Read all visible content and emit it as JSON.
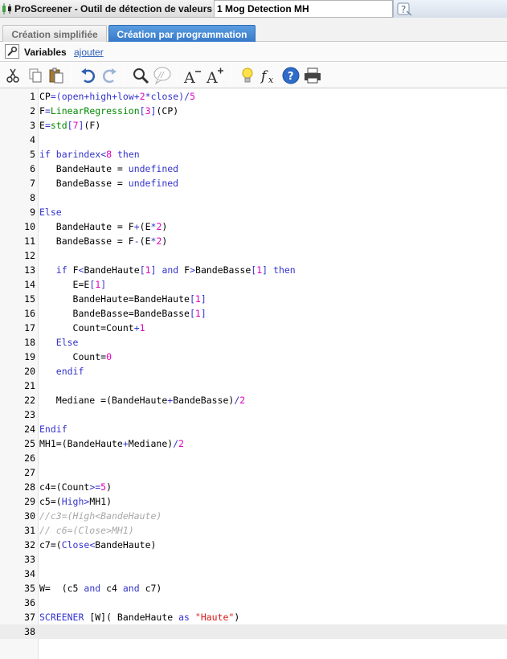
{
  "window": {
    "app_title": "ProScreener - Outil de détection de valeurs",
    "screener_name": "1 Mog Detection MH"
  },
  "tabs": [
    {
      "label": "Création simplifiée",
      "active": false
    },
    {
      "label": "Création par programmation",
      "active": true
    }
  ],
  "variables_bar": {
    "label": "Variables",
    "add_link": "ajouter"
  },
  "toolbar": {
    "icons": [
      "cut-icon",
      "copy-icon",
      "paste-icon",
      "undo-icon",
      "redo-icon",
      "search-icon",
      "comment-icon",
      "decrease-font-icon",
      "increase-font-icon",
      "lightbulb-icon",
      "function-icon",
      "help-icon",
      "print-icon"
    ]
  },
  "colors": {
    "keyword": "#3333cc",
    "function": "#008a00",
    "number": "#e000c0",
    "string": "#d81818",
    "comment": "#a8a8a8",
    "active_tab": "#3779c9"
  },
  "editor": {
    "current_line": 38,
    "lines": [
      {
        "n": "1",
        "tokens": [
          [
            "var",
            "CP"
          ],
          [
            "op",
            "=("
          ],
          [
            "kw",
            "open"
          ],
          [
            "op",
            "+"
          ],
          [
            "kw",
            "high"
          ],
          [
            "op",
            "+"
          ],
          [
            "kw",
            "low"
          ],
          [
            "op",
            "+"
          ],
          [
            "num",
            "2"
          ],
          [
            "op",
            "*"
          ],
          [
            "kw",
            "close"
          ],
          [
            "op",
            ")/"
          ],
          [
            "num",
            "5"
          ]
        ]
      },
      {
        "n": "2",
        "tokens": [
          [
            "var",
            "F"
          ],
          [
            "op",
            "="
          ],
          [
            "fn",
            "LinearRegression"
          ],
          [
            "op",
            "["
          ],
          [
            "num",
            "3"
          ],
          [
            "op",
            "]"
          ],
          [
            "var",
            "(CP)"
          ]
        ]
      },
      {
        "n": "3",
        "tokens": [
          [
            "var",
            "E"
          ],
          [
            "op",
            "="
          ],
          [
            "fn",
            "std"
          ],
          [
            "op",
            "["
          ],
          [
            "num",
            "7"
          ],
          [
            "op",
            "]"
          ],
          [
            "var",
            "(F)"
          ]
        ]
      },
      {
        "n": "4",
        "tokens": []
      },
      {
        "n": "5",
        "tokens": [
          [
            "kw",
            "if"
          ],
          [
            "var",
            " "
          ],
          [
            "kw",
            "barindex"
          ],
          [
            "op",
            "<"
          ],
          [
            "num",
            "8"
          ],
          [
            "var",
            " "
          ],
          [
            "kw",
            "then"
          ]
        ]
      },
      {
        "n": "6",
        "tokens": [
          [
            "var",
            "   BandeHaute = "
          ],
          [
            "kw",
            "undefined"
          ]
        ]
      },
      {
        "n": "7",
        "tokens": [
          [
            "var",
            "   BandeBasse = "
          ],
          [
            "kw",
            "undefined"
          ]
        ]
      },
      {
        "n": "8",
        "tokens": []
      },
      {
        "n": "9",
        "tokens": [
          [
            "kw",
            "Else"
          ]
        ]
      },
      {
        "n": "10",
        "tokens": [
          [
            "var",
            "   BandeHaute = F"
          ],
          [
            "op",
            "+"
          ],
          [
            "var",
            "(E"
          ],
          [
            "op",
            "*"
          ],
          [
            "num",
            "2"
          ],
          [
            "var",
            ")"
          ]
        ]
      },
      {
        "n": "11",
        "tokens": [
          [
            "var",
            "   BandeBasse = F"
          ],
          [
            "op",
            "-"
          ],
          [
            "var",
            "(E"
          ],
          [
            "op",
            "*"
          ],
          [
            "num",
            "2"
          ],
          [
            "var",
            ")"
          ]
        ]
      },
      {
        "n": "12",
        "tokens": []
      },
      {
        "n": "13",
        "tokens": [
          [
            "var",
            "   "
          ],
          [
            "kw",
            "if"
          ],
          [
            "var",
            " F"
          ],
          [
            "op",
            "<"
          ],
          [
            "var",
            "BandeHaute"
          ],
          [
            "op",
            "["
          ],
          [
            "num",
            "1"
          ],
          [
            "op",
            "]"
          ],
          [
            "var",
            " "
          ],
          [
            "kw",
            "and"
          ],
          [
            "var",
            " F"
          ],
          [
            "op",
            ">"
          ],
          [
            "var",
            "BandeBasse"
          ],
          [
            "op",
            "["
          ],
          [
            "num",
            "1"
          ],
          [
            "op",
            "]"
          ],
          [
            "var",
            " "
          ],
          [
            "kw",
            "then"
          ]
        ]
      },
      {
        "n": "14",
        "tokens": [
          [
            "var",
            "      E=E"
          ],
          [
            "op",
            "["
          ],
          [
            "num",
            "1"
          ],
          [
            "op",
            "]"
          ]
        ]
      },
      {
        "n": "15",
        "tokens": [
          [
            "var",
            "      BandeHaute=BandeHaute"
          ],
          [
            "op",
            "["
          ],
          [
            "num",
            "1"
          ],
          [
            "op",
            "]"
          ]
        ]
      },
      {
        "n": "16",
        "tokens": [
          [
            "var",
            "      BandeBasse=BandeBasse"
          ],
          [
            "op",
            "["
          ],
          [
            "num",
            "1"
          ],
          [
            "op",
            "]"
          ]
        ]
      },
      {
        "n": "17",
        "tokens": [
          [
            "var",
            "      Count=Count"
          ],
          [
            "op",
            "+"
          ],
          [
            "num",
            "1"
          ]
        ]
      },
      {
        "n": "18",
        "tokens": [
          [
            "var",
            "   "
          ],
          [
            "kw",
            "Else"
          ]
        ]
      },
      {
        "n": "19",
        "tokens": [
          [
            "var",
            "      Count="
          ],
          [
            "num",
            "0"
          ]
        ]
      },
      {
        "n": "20",
        "tokens": [
          [
            "var",
            "   "
          ],
          [
            "kw",
            "endif"
          ]
        ]
      },
      {
        "n": "21",
        "tokens": []
      },
      {
        "n": "22",
        "tokens": [
          [
            "var",
            "   Mediane =(BandeHaute"
          ],
          [
            "op",
            "+"
          ],
          [
            "var",
            "BandeBasse)"
          ],
          [
            "op",
            "/"
          ],
          [
            "num",
            "2"
          ]
        ]
      },
      {
        "n": "23",
        "tokens": []
      },
      {
        "n": "24",
        "tokens": [
          [
            "kw",
            "Endif"
          ]
        ]
      },
      {
        "n": "25",
        "tokens": [
          [
            "var",
            "MH1=(BandeHaute"
          ],
          [
            "op",
            "+"
          ],
          [
            "var",
            "Mediane)"
          ],
          [
            "op",
            "/"
          ],
          [
            "num",
            "2"
          ]
        ]
      },
      {
        "n": "26",
        "tokens": []
      },
      {
        "n": "27",
        "tokens": []
      },
      {
        "n": "28",
        "tokens": [
          [
            "var",
            "c4=(Count"
          ],
          [
            "op",
            ">="
          ],
          [
            "num",
            "5"
          ],
          [
            "var",
            ")"
          ]
        ]
      },
      {
        "n": "29",
        "tokens": [
          [
            "var",
            "c5=("
          ],
          [
            "kw",
            "High"
          ],
          [
            "op",
            ">"
          ],
          [
            "var",
            "MH1)"
          ]
        ]
      },
      {
        "n": "30",
        "tokens": [
          [
            "cmt",
            "//c3=(High<BandeHaute)"
          ]
        ]
      },
      {
        "n": "31",
        "tokens": [
          [
            "cmt",
            "// c6=(Close>MH1)"
          ]
        ]
      },
      {
        "n": "32",
        "tokens": [
          [
            "var",
            "c7=("
          ],
          [
            "kw",
            "Close"
          ],
          [
            "op",
            "<"
          ],
          [
            "var",
            "BandeHaute)"
          ]
        ]
      },
      {
        "n": "33",
        "tokens": []
      },
      {
        "n": "34",
        "tokens": []
      },
      {
        "n": "35",
        "tokens": [
          [
            "var",
            "W=  (c5 "
          ],
          [
            "kw",
            "and"
          ],
          [
            "var",
            " c4 "
          ],
          [
            "kw",
            "and"
          ],
          [
            "var",
            " c7)"
          ]
        ]
      },
      {
        "n": "36",
        "tokens": []
      },
      {
        "n": "37",
        "tokens": [
          [
            "kw",
            "SCREENER"
          ],
          [
            "var",
            " [W]( BandeHaute "
          ],
          [
            "kw",
            "as"
          ],
          [
            "var",
            " "
          ],
          [
            "str",
            "\"Haute\""
          ],
          [
            "var",
            ")"
          ]
        ]
      },
      {
        "n": "38",
        "tokens": []
      }
    ]
  }
}
